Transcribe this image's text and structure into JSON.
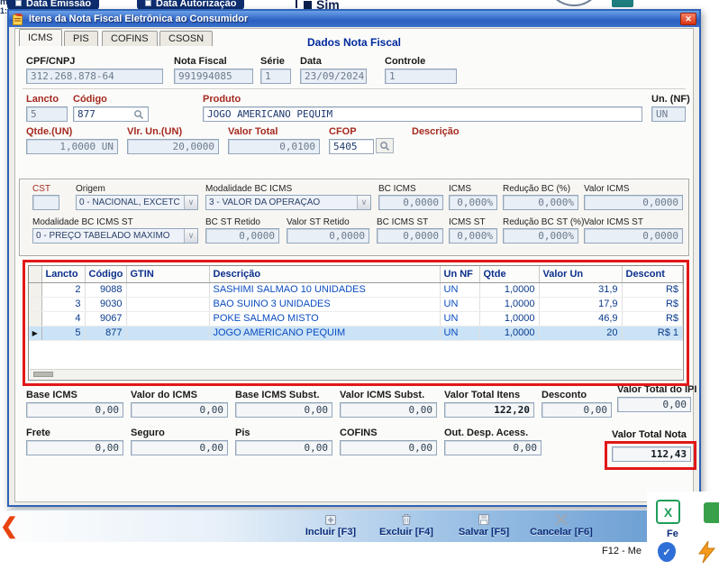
{
  "colors": {
    "titlebar_blue": "#2a5fc0",
    "annotation_red": "#e11818",
    "close_red": "#d9330f"
  },
  "icons": {
    "close": "✕",
    "dropdown": "∨",
    "row_arrow": "▶",
    "back_chevron": "❮",
    "check": "✓",
    "excel_glyph": "X"
  },
  "background": {
    "pill1": "Data Emissão",
    "pill2": "Data Autorização",
    "sim": "Sim",
    "frag1": "m",
    "frag2": "1:",
    "f12": "F12 - Me"
  },
  "dialog": {
    "title": "Itens da Nota Fiscal Eletrônica ao Consumidor",
    "section_title": "Dados Nota Fiscal",
    "header_fields": [
      {
        "label": "CPF/CNPJ",
        "value": "312.268.878-64"
      },
      {
        "label": "Nota Fiscal",
        "value": "991994085"
      },
      {
        "label": "Série",
        "value": "1"
      },
      {
        "label": "Data",
        "value": "23/09/2024"
      },
      {
        "label": "Controle",
        "value": "1"
      }
    ],
    "item": {
      "lancto_label": "Lancto",
      "lancto": "5",
      "codigo_label": "Código",
      "codigo": "877",
      "produto_label": "Produto",
      "produto": "JOGO AMERICANO PEQUIM",
      "un_label": "Un. (NF)",
      "un": "UN",
      "qtde_label": "Qtde.(UN)",
      "qtde": "1,0000 UN",
      "vlrun_label": "Vlr. Un.(UN)",
      "vlrun": "20,0000",
      "vtotal_label": "Valor Total",
      "vtotal": "0,0100",
      "cfop_label": "CFOP",
      "cfop": "5405",
      "descricao_label": "Descrição",
      "descricao": ""
    },
    "tabs": [
      {
        "label": "ICMS"
      },
      {
        "label": "PIS"
      },
      {
        "label": "COFINS"
      },
      {
        "label": "CSOSN"
      }
    ],
    "icms": {
      "cst_label": "CST",
      "cst": "",
      "origem_label": "Origem",
      "origem": "0 - NACIONAL, EXCETC",
      "modbc_label": "Modalidade BC ICMS",
      "modbc": "3 - VALOR DA OPERAÇÃO",
      "bcicms_label": "BC ICMS",
      "bcicms": "0,0000",
      "icms_label": "ICMS",
      "icms": "0,000%",
      "redbc_label": "Redução BC (%)",
      "redbc": "0,000%",
      "vicms_label": "Valor ICMS",
      "vicms": "0,0000",
      "modbcst_label": "Modalidade BC ICMS ST",
      "modbcst": "0 - PREÇO TABELADO MÁXIMO",
      "bcstret_label": "BC ST Retido",
      "bcstret": "0,0000",
      "vstret_label": "Valor ST Retido",
      "vstret": "0,0000",
      "bcicmsst_label": "BC ICMS ST",
      "bcicmsst": "0,0000",
      "icmsst_label": "ICMS ST",
      "icmsst": "0,000%",
      "redbcst_label": "Redução BC ST (%)",
      "redbcst": "0,000%",
      "vicmsst_label": "Valor ICMS ST",
      "vicmsst": "0,0000"
    },
    "grid": {
      "columns": [
        "Lancto",
        "Código",
        "GTIN",
        "Descrição",
        "Un NF",
        "Qtde",
        "Valor Un",
        "Descont"
      ],
      "rows": [
        [
          "2",
          "9088",
          "",
          "SASHIMI SALMAO 10 UNIDADES",
          "UN",
          "1,0000",
          "31,9",
          "R$"
        ],
        [
          "3",
          "9030",
          "",
          "BAO SUINO 3 UNIDADES",
          "UN",
          "1,0000",
          "17,9",
          "R$"
        ],
        [
          "4",
          "9067",
          "",
          "POKE SALMAO MISTO",
          "UN",
          "1,0000",
          "46,9",
          "R$"
        ],
        [
          "5",
          "877",
          "",
          "JOGO AMERICANO PEQUIM",
          "UN",
          "1,0000",
          "20",
          "R$ 1"
        ]
      ]
    },
    "totals1": [
      {
        "label": "Base ICMS",
        "value": "0,00"
      },
      {
        "label": "Valor do ICMS",
        "value": "0,00"
      },
      {
        "label": "Base ICMS Subst.",
        "value": "0,00"
      },
      {
        "label": "Valor ICMS Subst.",
        "value": "0,00"
      },
      {
        "label": "Valor Total Itens",
        "value": "122,20"
      },
      {
        "label": "Desconto",
        "value": "0,00"
      },
      {
        "label": "Valor Total do IPI",
        "value": "0,00"
      }
    ],
    "totals2": [
      {
        "label": "Frete",
        "value": "0,00"
      },
      {
        "label": "Seguro",
        "value": "0,00"
      },
      {
        "label": "Pis",
        "value": "0,00"
      },
      {
        "label": "COFINS",
        "value": "0,00"
      },
      {
        "label": "Out. Desp. Acess.",
        "value": "0,00"
      },
      {
        "label": "Valor Total Nota",
        "value": "112,43"
      }
    ],
    "buttons": [
      {
        "label": "Incluir [F3]"
      },
      {
        "label": "Excluir [F4]"
      },
      {
        "label": "Salvar [F5]"
      },
      {
        "label": "Cancelar [F6]"
      },
      {
        "label": "Fe"
      }
    ]
  }
}
